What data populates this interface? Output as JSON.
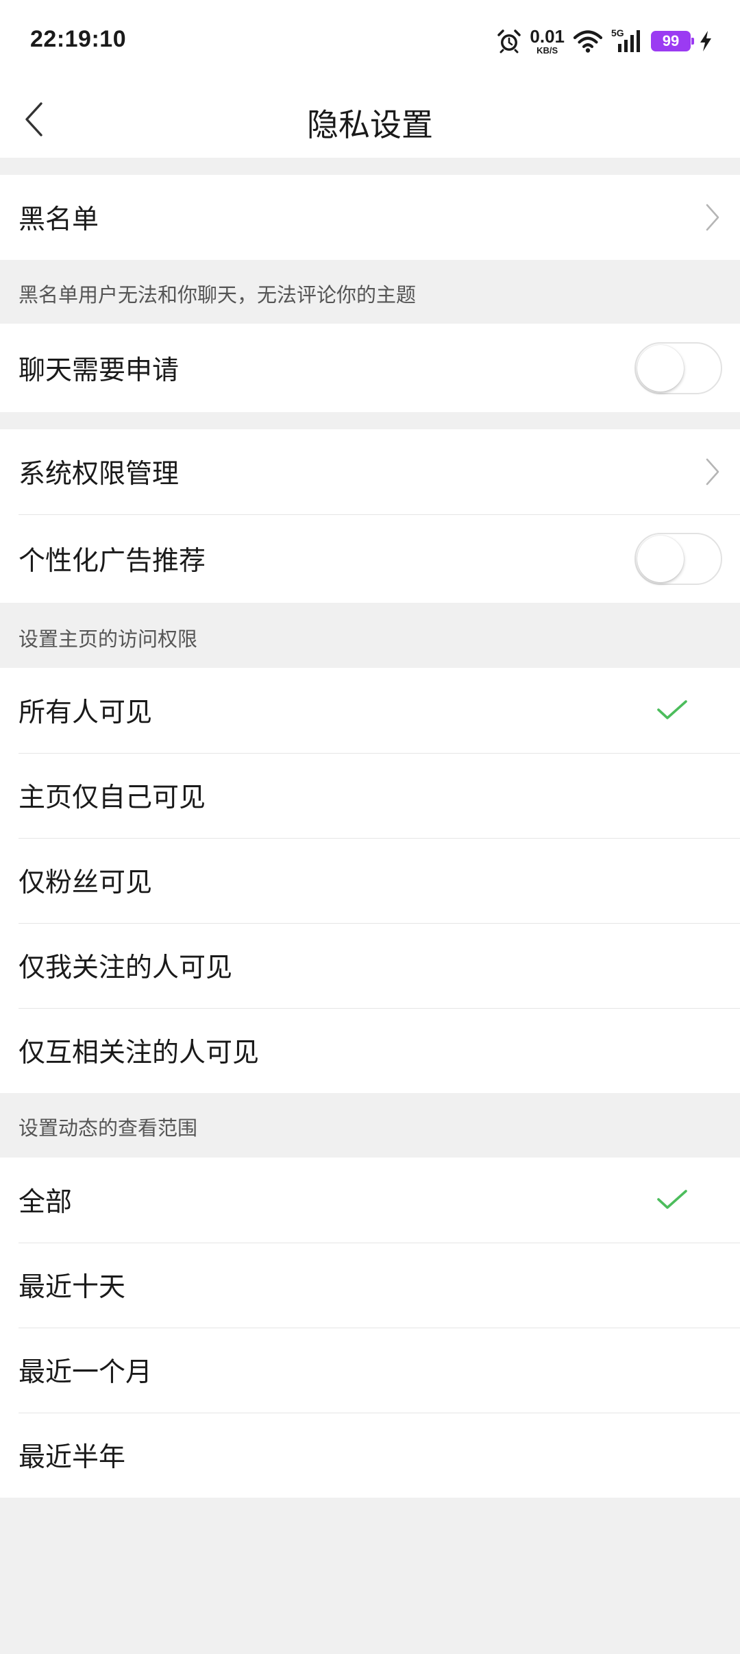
{
  "status_bar": {
    "time": "22:19:10",
    "net_speed_value": "0.01",
    "net_speed_unit": "KB/S",
    "network_type": "5G",
    "battery_level": "99",
    "battery_color": "#9b3bf2",
    "icons": [
      "alarm-icon",
      "wifi-icon",
      "signal-icon",
      "battery-icon",
      "charging-icon"
    ]
  },
  "header": {
    "title": "隐私设置",
    "back_icon": "chevron-left-icon"
  },
  "blacklist": {
    "label": "黑名单",
    "note": "黑名单用户无法和你聊天，无法评论你的主题"
  },
  "chat_request": {
    "label": "聊天需要申请",
    "enabled": false
  },
  "system_permissions": {
    "label": "系统权限管理"
  },
  "personalized_ads": {
    "label": "个性化广告推荐",
    "enabled": false
  },
  "homepage_access": {
    "header": "设置主页的访问权限",
    "options": [
      "所有人可见",
      "主页仅自己可见",
      "仅粉丝可见",
      "仅我关注的人可见",
      "仅互相关注的人可见"
    ],
    "selected_index": 0
  },
  "feed_range": {
    "header": "设置动态的查看范围",
    "options": [
      "全部",
      "最近十天",
      "最近一个月",
      "最近半年"
    ],
    "selected_index": 0
  },
  "colors": {
    "accent_check": "#4cbd5c",
    "background": "#f0f0f0",
    "surface": "#ffffff"
  }
}
